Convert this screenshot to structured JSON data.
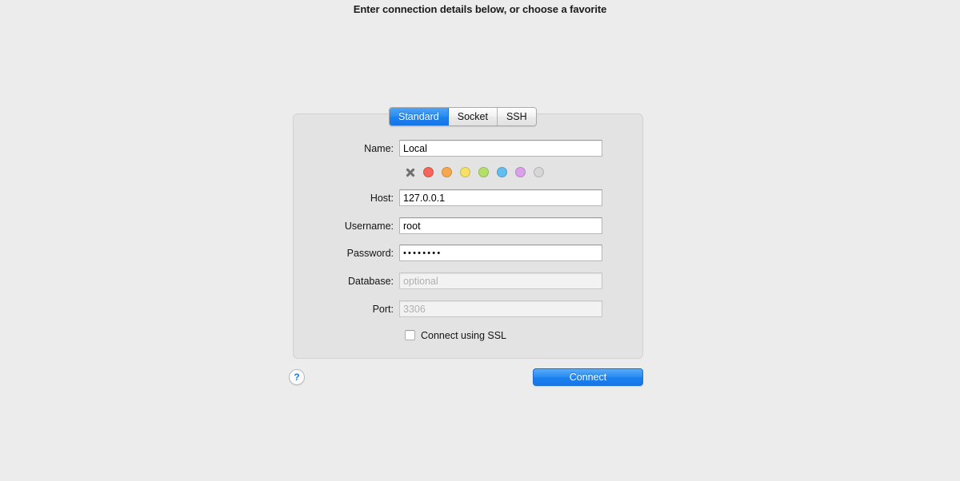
{
  "heading": "Enter connection details below, or choose a favorite",
  "tabs": [
    {
      "label": "Standard",
      "selected": true
    },
    {
      "label": "Socket",
      "selected": false
    },
    {
      "label": "SSH",
      "selected": false
    }
  ],
  "form": {
    "name": {
      "label": "Name:",
      "value": "Local",
      "placeholder": ""
    },
    "host": {
      "label": "Host:",
      "value": "127.0.0.1",
      "placeholder": ""
    },
    "username": {
      "label": "Username:",
      "value": "root",
      "placeholder": ""
    },
    "password": {
      "label": "Password:",
      "value": "••••••••",
      "placeholder": ""
    },
    "database": {
      "label": "Database:",
      "value": "",
      "placeholder": "optional"
    },
    "port": {
      "label": "Port:",
      "value": "",
      "placeholder": "3306"
    },
    "ssl": {
      "label": "Connect using SSL",
      "checked": false
    }
  },
  "swatches": {
    "clear_icon": "x-icon",
    "colors": [
      {
        "name": "red",
        "hex": "#f4655c"
      },
      {
        "name": "orange",
        "hex": "#f5a94e"
      },
      {
        "name": "yellow",
        "hex": "#f5e164"
      },
      {
        "name": "green",
        "hex": "#b4e06a"
      },
      {
        "name": "blue",
        "hex": "#62bdf0"
      },
      {
        "name": "purple",
        "hex": "#dba0ea"
      },
      {
        "name": "gray",
        "hex": "#d6d6d6"
      }
    ]
  },
  "footer": {
    "help_label": "?",
    "connect_label": "Connect"
  },
  "colors": {
    "accent": "#2a8df1",
    "window_bg": "#ececec",
    "panel_bg": "#e3e3e3"
  }
}
